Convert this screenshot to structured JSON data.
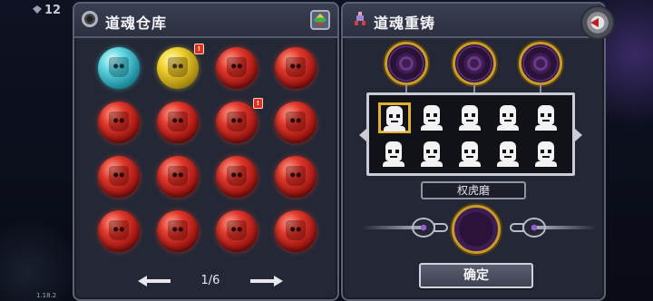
{
  "hud": {
    "value": "12"
  },
  "version": "1.18.2",
  "left_panel": {
    "title": "道魂仓库",
    "title_icon": "ring-icon",
    "action_icon": "dice-cube-icon",
    "orbs": [
      {
        "color": "cyan",
        "badge": false
      },
      {
        "color": "gold",
        "badge": true
      },
      {
        "color": "red",
        "badge": false
      },
      {
        "color": "red",
        "badge": false
      },
      {
        "color": "red",
        "badge": false
      },
      {
        "color": "red",
        "badge": false
      },
      {
        "color": "red",
        "badge": true
      },
      {
        "color": "red",
        "badge": false
      },
      {
        "color": "red",
        "badge": false
      },
      {
        "color": "red",
        "badge": false
      },
      {
        "color": "red",
        "badge": false
      },
      {
        "color": "red",
        "badge": false
      },
      {
        "color": "red",
        "badge": false
      },
      {
        "color": "red",
        "badge": false
      },
      {
        "color": "red",
        "badge": false
      },
      {
        "color": "red",
        "badge": false
      }
    ],
    "badge_text": "!",
    "pager": {
      "label": "1/6"
    }
  },
  "right_panel": {
    "title": "道魂重铸",
    "title_icon": "sword-figure-icon",
    "close_icon": "back-arrow-icon",
    "socket_count": 3,
    "portraits_selected_index": 0,
    "portrait_count": 10,
    "selected_name": "权虎磨",
    "confirm_label": "确定"
  },
  "colors": {
    "panel": "#242836",
    "border": "#5c6274",
    "gold_frame": "#c89c2c",
    "orb_red": "#e0382c",
    "orb_cyan": "#5fd6e0",
    "orb_gold": "#f0d030",
    "badge_red": "#e03020"
  }
}
